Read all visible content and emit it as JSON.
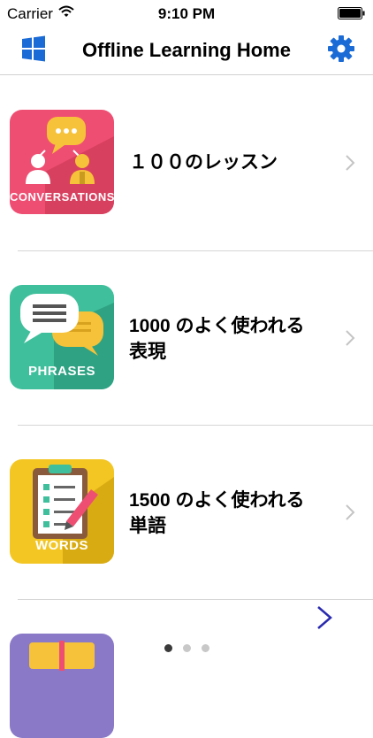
{
  "status_bar": {
    "carrier": "Carrier",
    "time": "9:10 PM"
  },
  "nav": {
    "title": "Offline Learning Home",
    "left_icon": "windows-icon",
    "right_icon": "gear-icon",
    "accent_color": "#1a6bd6"
  },
  "items": [
    {
      "label": "１００のレッスン",
      "thumb_label": "CONVERSATIONS",
      "thumb_color": "#ef4e73"
    },
    {
      "label": "1000 のよく使われる表現",
      "thumb_label": "PHRASES",
      "thumb_color": "#3fbf9b"
    },
    {
      "label": "1500 のよく使われる単語",
      "thumb_label": "WORDS",
      "thumb_color": "#f3c623"
    },
    {
      "label": "",
      "thumb_label": "",
      "thumb_color": "#8a79c7"
    }
  ],
  "pager": {
    "pages": 3,
    "current": 1,
    "next_icon": "chevron-right-icon"
  }
}
